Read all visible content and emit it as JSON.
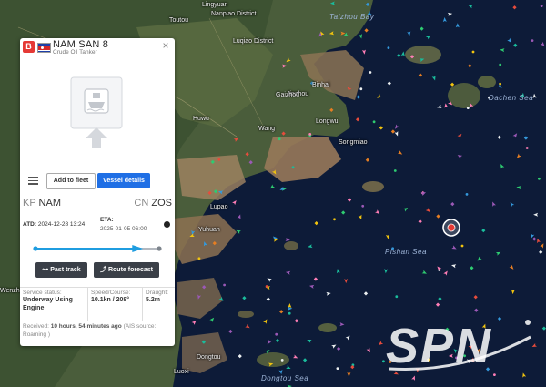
{
  "map": {
    "place_labels": [
      "Toutou",
      "Lingyuan",
      "Nanpiao District",
      "Luqiao District",
      "Binhai",
      "Huwu",
      "Jinzhou",
      "Longwu",
      "Gaizhou",
      "Songmiao",
      "Wang",
      "Yuhuan",
      "Lupao",
      "Dongtou",
      "Luoxi",
      "Wenzhou"
    ],
    "sea_labels": [
      "Taizhou Bay",
      "Dachen Sea",
      "Pishan Sea",
      "Dongtou Sea"
    ]
  },
  "panel": {
    "status_chip": "B",
    "vessel_name": "NAM SAN 8",
    "vessel_type": "Crude Oil Tanker",
    "add_to_fleet": "Add to fleet",
    "vessel_details": "Vessel details",
    "departure": {
      "country": "KP",
      "port": "NAM"
    },
    "arrival": {
      "country": "CN",
      "port": "ZOS"
    },
    "atd_label": "ATD:",
    "atd_value": "2024-12-28 13:24",
    "eta_label": "ETA:",
    "eta_value": "2025-01-05 06:00",
    "progress": 0.87,
    "past_track": "Past track",
    "route_forecast": "Route forecast",
    "stats": [
      {
        "label": "Service status:",
        "value": "Underway Using Engine"
      },
      {
        "label": "Speed/Course:",
        "value": "10.1kn / 208°"
      },
      {
        "label": "Draught:",
        "value": "5.2m"
      }
    ],
    "received_prefix": "Received:",
    "received_time": "10 hours, 54 minutes ago",
    "received_source": "(AIS source: Roaming )"
  },
  "watermark": {
    "text": "SPN"
  },
  "colors": {
    "accent": "#1f6fe5",
    "status": "#e53935",
    "sea": "#0c1a36",
    "land": "#4b5e3d"
  }
}
